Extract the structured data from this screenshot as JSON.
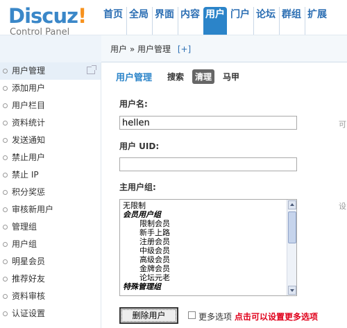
{
  "brand": {
    "name": "Discuz",
    "bang": "!",
    "subtitle": "Control Panel"
  },
  "topnav": [
    "首页",
    "全局",
    "界面",
    "内容",
    "用户",
    "门户",
    "论坛",
    "群组",
    "扩展"
  ],
  "topnav_active": "用户",
  "breadcrumb": {
    "path": "用户 » 用户管理",
    "add": "[+]"
  },
  "sidebar": [
    "用户管理",
    "添加用户",
    "用户栏目",
    "资料统计",
    "发送通知",
    "禁止用户",
    "禁止 IP",
    "积分奖惩",
    "审核新用户",
    "管理组",
    "用户组",
    "明星会员",
    "推荐好友",
    "资料审核",
    "认证设置"
  ],
  "main": {
    "title": "用户管理",
    "tabs": [
      "搜索",
      "清理",
      "马甲"
    ],
    "active_tab": "清理"
  },
  "form": {
    "username_label": "用户名:",
    "username_value": "hellen",
    "username_hint": "可",
    "uid_label": "用户 UID:",
    "uid_value": "",
    "group_label": "主用户组:",
    "group_hint": "设",
    "group_options": [
      {
        "text": "无限制",
        "kind": "plain"
      },
      {
        "text": "会员用户组",
        "kind": "group"
      },
      {
        "text": "限制会员",
        "kind": "sub"
      },
      {
        "text": "新手上路",
        "kind": "sub"
      },
      {
        "text": "注册会员",
        "kind": "sub"
      },
      {
        "text": "中级会员",
        "kind": "sub"
      },
      {
        "text": "高级会员",
        "kind": "sub"
      },
      {
        "text": "金牌会员",
        "kind": "sub"
      },
      {
        "text": "论坛元老",
        "kind": "sub"
      },
      {
        "text": "特殊管理组",
        "kind": "group"
      }
    ]
  },
  "actions": {
    "delete_label": "删除用户",
    "more_options_label": "更多选项",
    "more_hint": "点击可以设置更多选项"
  },
  "colors": {
    "accent": "#2b84c9",
    "brand_orange": "#f7921e",
    "hint_red": "#e0001b"
  }
}
